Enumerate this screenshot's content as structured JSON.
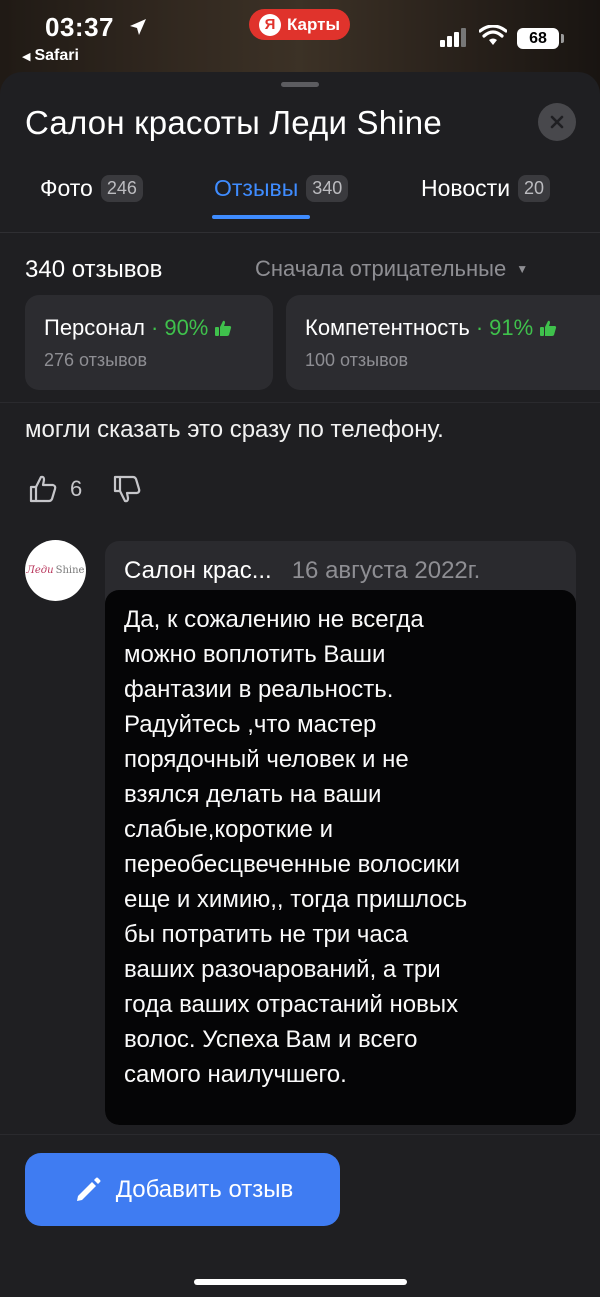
{
  "status_bar": {
    "time": "03:37",
    "back_app": "Safari",
    "maps_pill_logo": "Я",
    "maps_pill_label": "Карты",
    "battery": "68"
  },
  "header": {
    "title": "Салон красоты Леди Shine"
  },
  "tabs": [
    {
      "label": "Фото",
      "count": "246",
      "active": false
    },
    {
      "label": "Отзывы",
      "count": "340",
      "active": true
    },
    {
      "label": "Новости",
      "count": "20",
      "active": false
    }
  ],
  "reviews": {
    "count_label": "340 отзывов",
    "sort_label": "Сначала отрицательные"
  },
  "aspects": [
    {
      "name": "Персонал",
      "separator": "·",
      "percent": "90%",
      "count": "276 отзывов"
    },
    {
      "name": "Компетентность",
      "separator": "·",
      "percent": "91%",
      "count": "100 отзывов"
    }
  ],
  "review": {
    "tail_text": "могли сказать это сразу по телефону.",
    "likes": "6"
  },
  "reply": {
    "avatar_text_script": "Леди",
    "avatar_text_plain": "Shine",
    "author": "Салон крас...",
    "date": "16 августа 2022г.",
    "text": "Да, к сожалению не всегда\nможно воплотить Ваши\nфантазии  в реальность.\nРадуйтесь ,что мастер\nпорядочный человек и не\nвзялся делать на ваши\nслабые,короткие и\nпереобесцвеченные волосики\nеще и химию,, тогда пришлось\nбы потратить не три часа\nваших разочарований, а три\nгода ваших отрастаний новых\nволос. Успеха Вам и всего\nсамого наилучшего."
  },
  "actions": {
    "add_review_label": "Добавить отзыв"
  },
  "colors": {
    "accent": "#3f8cff",
    "button": "#3f7cf2",
    "positive": "#3fc14c",
    "maps_red": "#e0332c"
  },
  "icons": [
    "location-arrow-icon",
    "signal-icon",
    "wifi-icon",
    "battery-icon",
    "close-icon",
    "thumbs-up-icon",
    "thumbs-down-icon",
    "caret-down-icon",
    "pencil-icon"
  ]
}
